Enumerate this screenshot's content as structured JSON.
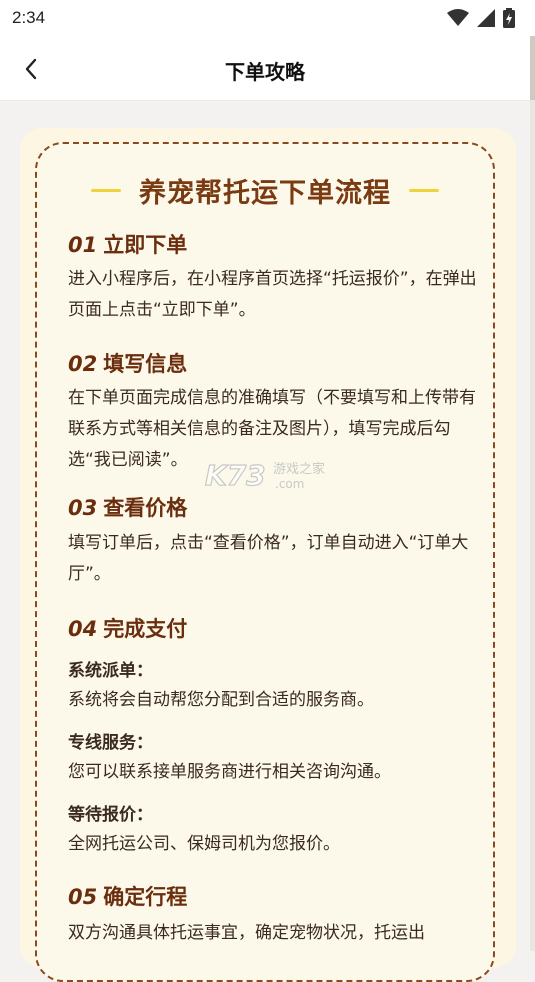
{
  "status_bar": {
    "time": "2:34"
  },
  "nav": {
    "title": "下单攻略"
  },
  "content": {
    "heading": "养宠帮托运下单流程",
    "steps": [
      {
        "num": "01",
        "title": "立即下单",
        "text": "进入小程序后，在小程序首页选择“托运报价”，在弹出页面上点击“立即下单”。"
      },
      {
        "num": "02",
        "title": "填写信息",
        "text": "在下单页面完成信息的准确填写（不要填写和上传带有联系方式等相关信息的备注及图片），填写完成后勾选“我已阅读”。"
      },
      {
        "num": "03",
        "title": "查看价格",
        "text": "填写订单后，点击“查看价格”，订单自动进入“订单大厅”。"
      },
      {
        "num": "04",
        "title": "完成支付",
        "items": [
          {
            "label": "系统派单：",
            "text": "系统将会自动帮您分配到合适的服务商。"
          },
          {
            "label": "专线服务：",
            "text": "您可以联系接单服务商进行相关咨询沟通。"
          },
          {
            "label": "等待报价：",
            "text": "全网托运公司、保姆司机为您报价。"
          }
        ]
      },
      {
        "num": "05",
        "title": "确定行程",
        "text": "双方沟通具体托运事宜，确定宠物状况，托运出"
      }
    ]
  },
  "watermark": {
    "brand": "K73",
    "text": "游戏之家",
    "domain": ".com"
  },
  "colors": {
    "accent": "#7a3a12",
    "card": "#fcf6e2",
    "dash": "#f0d23c"
  }
}
